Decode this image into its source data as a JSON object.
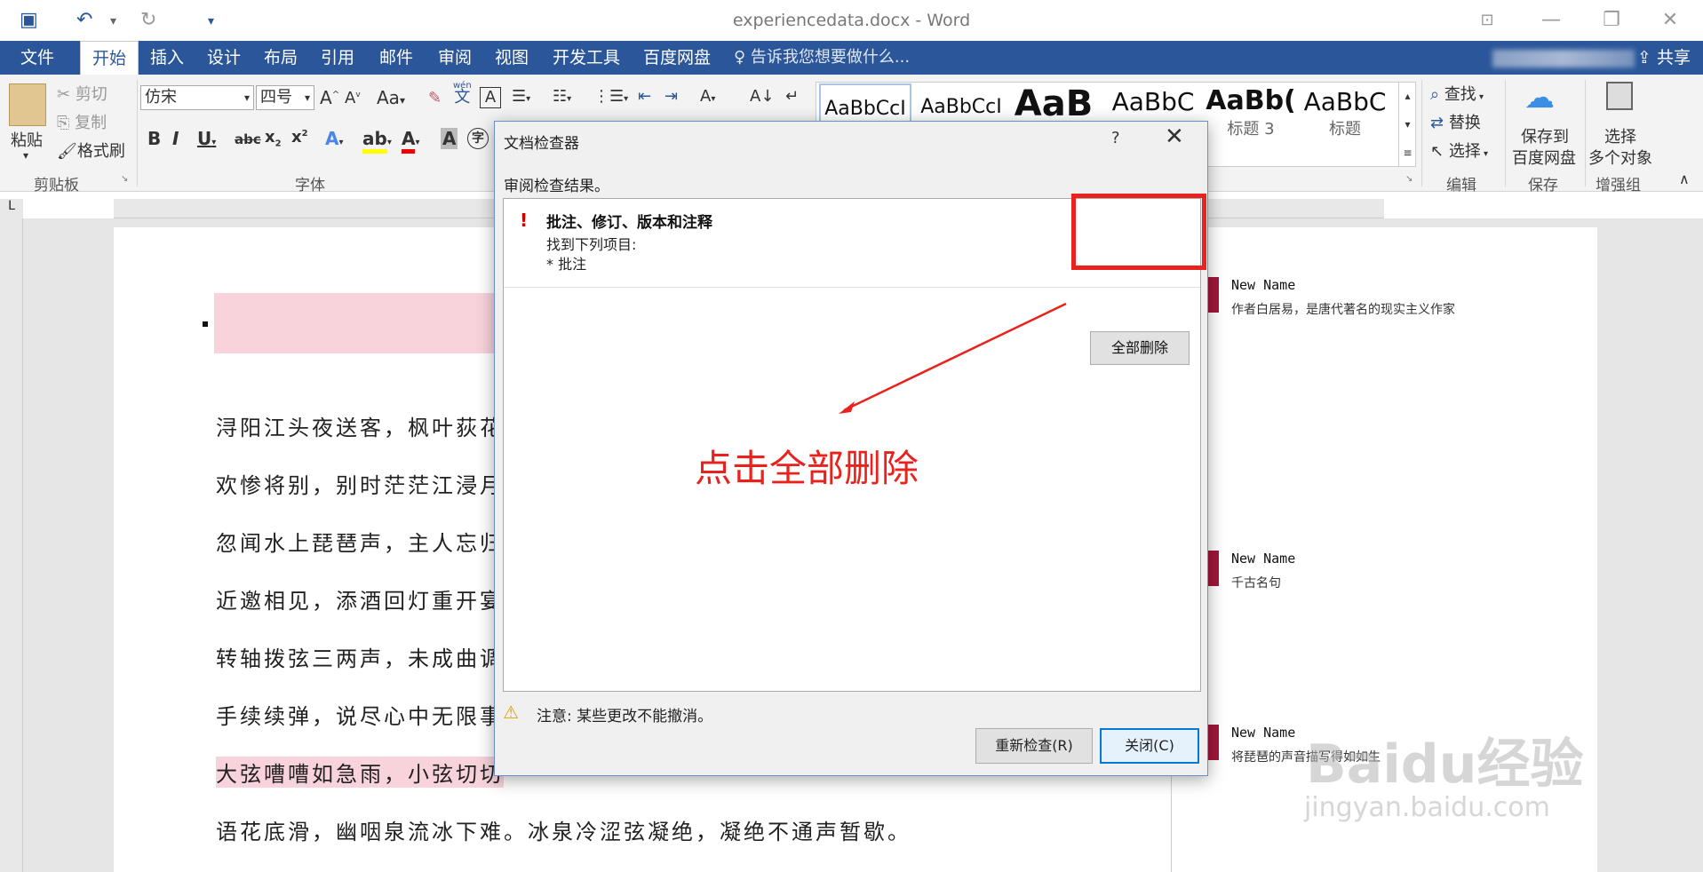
{
  "window": {
    "title": "experiencedata.docx - Word"
  },
  "qat": {
    "save": "save-icon",
    "undo": "undo-icon",
    "redo": "redo-icon"
  },
  "tabs": [
    {
      "label": "文件"
    },
    {
      "label": "开始"
    },
    {
      "label": "插入"
    },
    {
      "label": "设计"
    },
    {
      "label": "布局"
    },
    {
      "label": "引用"
    },
    {
      "label": "邮件"
    },
    {
      "label": "审阅"
    },
    {
      "label": "视图"
    },
    {
      "label": "开发工具"
    },
    {
      "label": "百度网盘"
    }
  ],
  "tellme": "告诉我您想要做什么...",
  "share": "共享",
  "ribbon": {
    "clipboard": {
      "paste": "粘贴",
      "cut": "剪切",
      "copy": "复制",
      "format_painter": "格式刷",
      "group": "剪贴板"
    },
    "font": {
      "name": "仿宋",
      "size": "四号",
      "group": "字体",
      "aa": "Aa",
      "wen": "wén",
      "wen_char": "文"
    },
    "styles": [
      {
        "preview": "AaBbCcI",
        "label": ""
      },
      {
        "preview": "AaBbCcI",
        "label": ""
      },
      {
        "preview": "AaB",
        "label": ""
      },
      {
        "preview": "AaBbC",
        "label": ""
      },
      {
        "preview": "AaBb(",
        "label": "标题 3"
      },
      {
        "preview": "AaBbC",
        "label": "标题"
      }
    ],
    "editing": {
      "find": "查找",
      "replace": "替换",
      "select": "选择",
      "group": "编辑"
    },
    "save_group": {
      "label1": "保存到",
      "label2": "百度网盘",
      "group": "保存"
    },
    "enhance": {
      "label1": "选择",
      "label2": "多个对象",
      "group": "增强组"
    }
  },
  "document": {
    "lines": [
      "浔阳江头夜送客，枫叶荻花",
      "欢惨将别，别时茫茫江浸月",
      "忽闻水上琵琶声，主人忘归",
      "近邀相见，添酒回灯重开宴",
      "转轴拨弦三两声，未成曲调",
      "手续续弹，说尽心中无限事",
      "大弦嘈嘈如急雨，小弦切切",
      "语花底滑，幽咽泉流冰下难。冰泉冷涩弦凝绝，凝绝不通声暂歇。"
    ],
    "comments": [
      {
        "author": "New Name",
        "text": "作者白居易，是唐代著名的现实主义作家"
      },
      {
        "author": "New Name",
        "text": "千古名句"
      },
      {
        "author": "New Name",
        "text": "将琵琶的声音描写得如如生"
      }
    ]
  },
  "dialog": {
    "title": "文档检查器",
    "help": "?",
    "subtitle": "审阅检查结果。",
    "section_title": "批注、修订、版本和注释",
    "found": "找到下列项目:",
    "item": "* 批注",
    "remove_all": "全部删除",
    "warning": "注意: 某些更改不能撤消。",
    "recheck": "重新检查(R)",
    "close": "关闭(C)"
  },
  "annotation": "点击全部删除",
  "watermark": {
    "brand": "Baidu经验",
    "url": "jingyan.baidu.com"
  },
  "colors": {
    "ribbon": "#2b579a",
    "highlight": "#e8231e",
    "comment": "#a3163a"
  }
}
